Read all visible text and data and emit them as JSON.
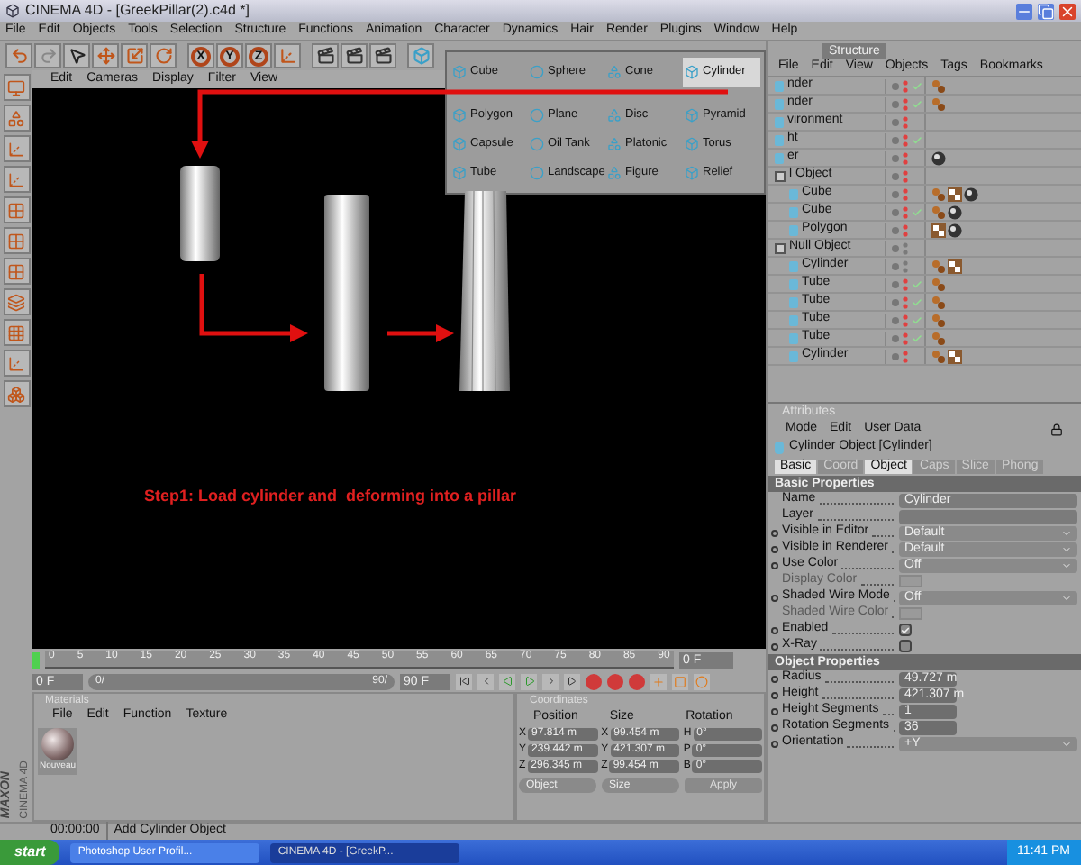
{
  "window": {
    "title": "CINEMA 4D - [GreekPillar(2).c4d *]"
  },
  "menu": [
    "File",
    "Edit",
    "Objects",
    "Tools",
    "Selection",
    "Structure",
    "Functions",
    "Animation",
    "Character",
    "Dynamics",
    "Hair",
    "Render",
    "Plugins",
    "Window",
    "Help"
  ],
  "toolbar": {
    "axes": [
      "X",
      "Y",
      "Z"
    ]
  },
  "viewport": {
    "menu": [
      "Edit",
      "Cameras",
      "Display",
      "Filter",
      "View"
    ],
    "annotation": "Step1: Load cylinder and  deforming into a pillar"
  },
  "primitive_menu": [
    {
      "label": "Cube",
      "selected": false
    },
    {
      "label": "Sphere",
      "selected": false
    },
    {
      "label": "Cone",
      "selected": false
    },
    {
      "label": "Cylinder",
      "selected": true
    },
    {
      "label": "Polygon",
      "selected": false
    },
    {
      "label": "Plane",
      "selected": false
    },
    {
      "label": "Disc",
      "selected": false
    },
    {
      "label": "Pyramid",
      "selected": false
    },
    {
      "label": "Capsule",
      "selected": false
    },
    {
      "label": "Oil Tank",
      "selected": false
    },
    {
      "label": "Platonic",
      "selected": false
    },
    {
      "label": "Torus",
      "selected": false
    },
    {
      "label": "Tube",
      "selected": false
    },
    {
      "label": "Landscape",
      "selected": false
    },
    {
      "label": "Figure",
      "selected": false
    },
    {
      "label": "Relief",
      "selected": false
    }
  ],
  "objects": {
    "tab": "Structure",
    "menu": [
      "File",
      "Edit",
      "View",
      "Objects",
      "Tags",
      "Bookmarks"
    ],
    "items": [
      {
        "name": "nder",
        "hidden": true,
        "enabled": true,
        "tags": [
          {
            "kind": "phong"
          }
        ]
      },
      {
        "name": "nder",
        "hidden": true,
        "enabled": true,
        "tags": [
          {
            "kind": "phong"
          }
        ]
      },
      {
        "name": "vironment",
        "hidden": true,
        "enabled": false
      },
      {
        "name": "ht",
        "hidden": true,
        "enabled": true
      },
      {
        "name": "er",
        "hidden": true,
        "enabled": false,
        "tags": [
          {
            "kind": "material"
          }
        ]
      },
      {
        "name": "l Object",
        "hidden": true,
        "enabled": false,
        "children": [
          {
            "name": "Cube",
            "hidden": true,
            "enabled": false,
            "tags": [
              {
                "kind": "phong"
              },
              {
                "kind": "texture"
              },
              {
                "kind": "material"
              }
            ]
          },
          {
            "name": "Cube",
            "hidden": true,
            "enabled": true,
            "tags": [
              {
                "kind": "phong"
              },
              {
                "kind": "material"
              }
            ]
          },
          {
            "name": "Polygon",
            "hidden": true,
            "enabled": false,
            "tags": [
              {
                "kind": "texture"
              },
              {
                "kind": "material"
              }
            ]
          }
        ]
      },
      {
        "name": "Null Object",
        "hidden": false,
        "enabled": false,
        "children": [
          {
            "name": "Cylinder",
            "hidden": false,
            "enabled": false,
            "tags": [
              {
                "kind": "phong"
              },
              {
                "kind": "texture"
              }
            ]
          },
          {
            "name": "Tube",
            "hidden": true,
            "enabled": true,
            "tags": [
              {
                "kind": "phong"
              }
            ]
          },
          {
            "name": "Tube",
            "hidden": true,
            "enabled": true,
            "tags": [
              {
                "kind": "phong"
              }
            ]
          },
          {
            "name": "Tube",
            "hidden": true,
            "enabled": true,
            "tags": [
              {
                "kind": "phong"
              }
            ]
          },
          {
            "name": "Tube",
            "hidden": true,
            "enabled": true,
            "tags": [
              {
                "kind": "phong"
              }
            ]
          },
          {
            "name": "Cylinder",
            "hidden": true,
            "enabled": false,
            "tags": [
              {
                "kind": "phong"
              },
              {
                "kind": "texture"
              }
            ]
          }
        ]
      }
    ]
  },
  "attributes": {
    "title": "Attributes",
    "menu": [
      "Mode",
      "Edit",
      "User Data"
    ],
    "object_title": "Cylinder Object [Cylinder]",
    "tabs": [
      {
        "label": "Basic",
        "selected": true
      },
      {
        "label": "Coord",
        "selected": false
      },
      {
        "label": "Object",
        "selected": true
      },
      {
        "label": "Caps",
        "selected": false
      },
      {
        "label": "Slice",
        "selected": false
      },
      {
        "label": "Phong",
        "selected": false
      }
    ],
    "sections": [
      {
        "title": "Basic Properties",
        "fields": [
          {
            "kind": "text",
            "label": "Name",
            "value": "Cylinder",
            "animatable": false,
            "disabled": false
          },
          {
            "kind": "text",
            "label": "Layer",
            "animatable": false,
            "disabled": false
          },
          {
            "kind": "select",
            "label": "Visible in Editor",
            "value": "Default",
            "animatable": true,
            "disabled": false
          },
          {
            "kind": "select",
            "label": "Visible in Renderer",
            "value": "Default",
            "animatable": true,
            "disabled": false
          },
          {
            "kind": "select",
            "label": "Use Color",
            "value": "Off",
            "animatable": true,
            "disabled": false
          },
          {
            "kind": "color",
            "label": "Display Color",
            "animatable": false,
            "disabled": true
          },
          {
            "kind": "select",
            "label": "Shaded Wire Mode",
            "value": "Off",
            "animatable": true,
            "disabled": false
          },
          {
            "kind": "color",
            "label": "Shaded Wire Color",
            "animatable": false,
            "disabled": true
          },
          {
            "kind": "check",
            "label": "Enabled",
            "checked": true,
            "animatable": true,
            "disabled": false
          },
          {
            "kind": "check",
            "label": "X-Ray",
            "checked": false,
            "animatable": true,
            "disabled": false
          }
        ]
      },
      {
        "title": "Object Properties",
        "fields": [
          {
            "kind": "number",
            "label": "Radius",
            "value": "49.727 m",
            "animatable": true,
            "disabled": false
          },
          {
            "kind": "number",
            "label": "Height",
            "value": "421.307 m",
            "animatable": true,
            "disabled": false
          },
          {
            "kind": "number",
            "label": "Height Segments",
            "value": "1",
            "animatable": true,
            "disabled": false
          },
          {
            "kind": "number",
            "label": "Rotation Segments",
            "value": "36",
            "animatable": true,
            "disabled": false
          },
          {
            "kind": "select",
            "label": "Orientation",
            "value": "+Y",
            "animatable": true,
            "disabled": false
          }
        ]
      }
    ]
  },
  "timeline": {
    "ticks": [
      "0",
      "5",
      "10",
      "15",
      "20",
      "25",
      "30",
      "35",
      "40",
      "45",
      "50",
      "55",
      "60",
      "65",
      "70",
      "75",
      "80",
      "85",
      "90"
    ],
    "current": "0 F"
  },
  "controls": {
    "start": "0 F",
    "range": {
      "start": "0/",
      "end": "90/",
      "level": 1
    },
    "end": "90 F"
  },
  "materials": {
    "title": "Materials",
    "menu": [
      "File",
      "Edit",
      "Function",
      "Texture"
    ],
    "items": [
      {
        "name": "Nouveau"
      }
    ]
  },
  "coordinates": {
    "title": "Coordinates",
    "headers": [
      "Position",
      "Size",
      "Rotation"
    ],
    "rows": [
      {
        "cells": [
          {
            "axis": "X",
            "value": "97.814 m"
          },
          {
            "axis": "X",
            "value": "99.454 m"
          },
          {
            "axis": "H",
            "value": "0°"
          }
        ]
      },
      {
        "cells": [
          {
            "axis": "Y",
            "value": "239.442 m"
          },
          {
            "axis": "Y",
            "value": "421.307 m"
          },
          {
            "axis": "P",
            "value": "0°"
          }
        ]
      },
      {
        "cells": [
          {
            "axis": "Z",
            "value": "296.345 m"
          },
          {
            "axis": "Z",
            "value": "99.454 m"
          },
          {
            "axis": "B",
            "value": "0°"
          }
        ]
      }
    ],
    "dropdowns": [
      "Object",
      "Size"
    ],
    "apply": "Apply"
  },
  "brand": {
    "maker": "MAXON",
    "product": "CINEMA 4D"
  },
  "status": {
    "time": "00:00:00",
    "message": "Add Cylinder Object"
  },
  "taskbar": {
    "start": "start",
    "tasks": [
      {
        "label": "Photoshop User Profil...",
        "selected": false
      },
      {
        "label": "CINEMA 4D - [GreekP...",
        "selected": true
      }
    ],
    "clock": "11:41 PM"
  }
}
